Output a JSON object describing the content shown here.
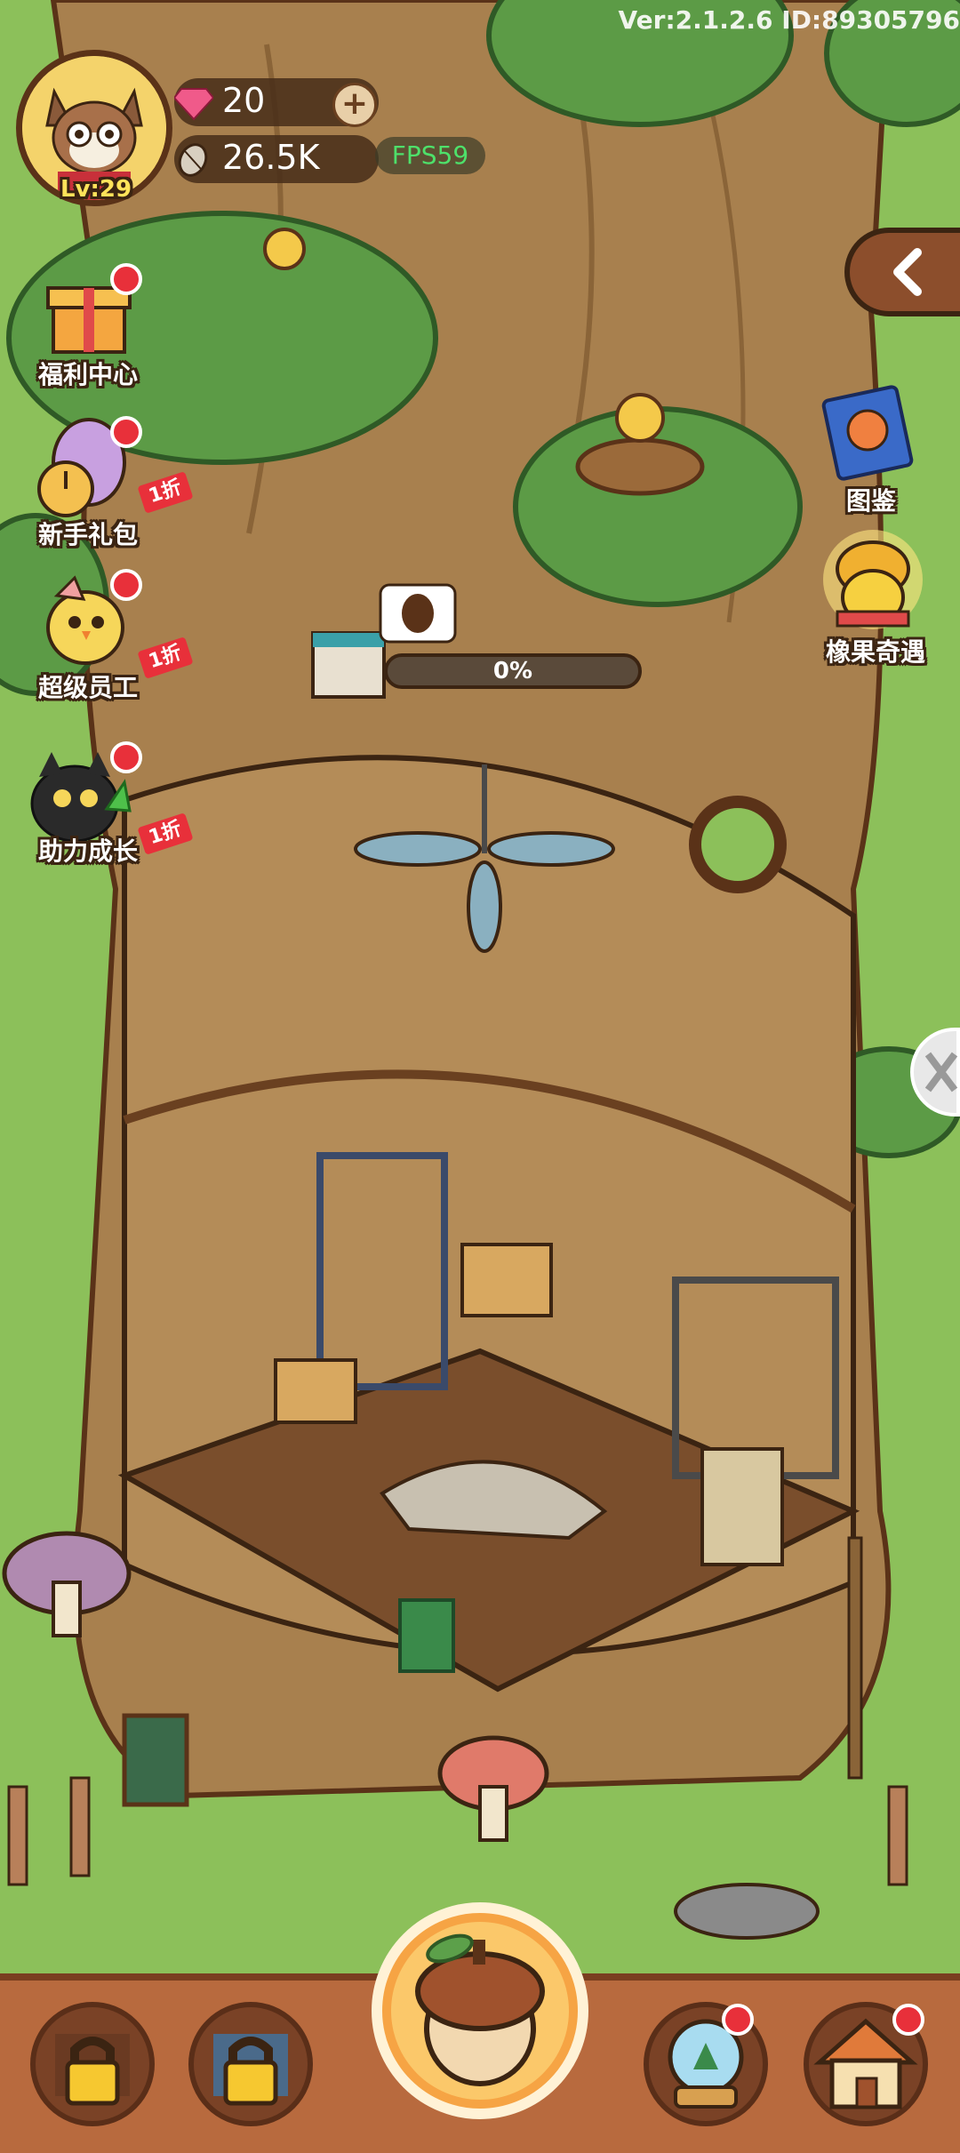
{
  "header": {
    "version": "Ver:2.1.2.6 ID:89305796",
    "level": "Lv:29",
    "gems": "20",
    "seeds": "26.5K",
    "fps": "FPS59"
  },
  "left_menu": [
    {
      "label": "福利中心",
      "icon": "gift-box-icon",
      "badge": true,
      "discount": ""
    },
    {
      "label": "新手礼包",
      "icon": "egg-clock-icon",
      "badge": true,
      "discount": "1折"
    },
    {
      "label": "超级员工",
      "icon": "chick-worker-icon",
      "badge": true,
      "discount": "1折"
    },
    {
      "label": "助力成长",
      "icon": "black-cat-icon",
      "badge": true,
      "discount": "1折"
    }
  ],
  "right_menu": [
    {
      "label": "图鉴",
      "icon": "book-icon"
    },
    {
      "label": "橡果奇遇",
      "icon": "acorn-bell-icon"
    }
  ],
  "building": {
    "progress_label": "0%",
    "progress_value": 0
  },
  "bottom_nav": [
    {
      "name": "locked-slot-1",
      "icon": "lock-icon"
    },
    {
      "name": "locked-slot-2",
      "icon": "lock-icon"
    },
    {
      "name": "acorn-main",
      "icon": "acorn-icon"
    },
    {
      "name": "snow-globe",
      "icon": "snow-globe-icon",
      "badge": true
    },
    {
      "name": "house",
      "icon": "house-icon",
      "badge": true
    }
  ],
  "colors": {
    "grass": "#8cc05a",
    "trunk": "#a8804e",
    "room_wall": "#b48c58",
    "floor": "#7a4e2c",
    "bottom_bar": "#b86a3e",
    "badge_red": "#e8303a",
    "fps_green": "#4ee06a"
  }
}
